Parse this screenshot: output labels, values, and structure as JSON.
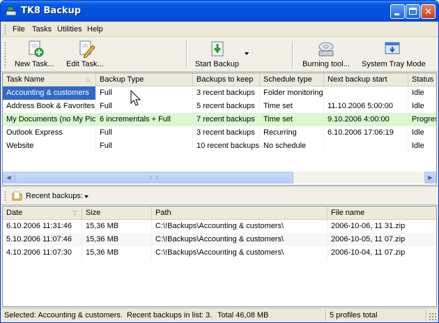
{
  "window": {
    "title": "TK8 Backup"
  },
  "menu": {
    "items": [
      "File",
      "Tasks",
      "Utilities",
      "Help"
    ]
  },
  "toolbar": {
    "new_task": "New Task...",
    "edit_task": "Edit Task...",
    "start_backup": "Start Backup",
    "burning_tools": "Burning tool...",
    "system_tray": "System Tray Mode"
  },
  "tasks": {
    "columns": [
      "Task Name",
      "Backup Type",
      "Backups to keep",
      "Schedule type",
      "Next backup start",
      "Status"
    ],
    "rows": [
      {
        "name": "Accounting & customers",
        "type": "Full",
        "keep": "3 recent backups",
        "schedule": "Folder monitoring",
        "next": "",
        "status": "Idle"
      },
      {
        "name": "Address Book & Favorites",
        "type": "Full",
        "keep": "5 recent backups",
        "schedule": "Time set",
        "next": "11.10.2006 5:00:00",
        "status": "Idle"
      },
      {
        "name": "My Documents (no My Pictu",
        "type": "6 incrementals + Full",
        "keep": "7 recent backups",
        "schedule": "Time set",
        "next": "9.10.2006 4:00:00",
        "status": "Progres"
      },
      {
        "name": "Outlook Express",
        "type": "Full",
        "keep": "3 recent backups",
        "schedule": "Recurring",
        "next": "6.10.2006 17:06:19",
        "status": "Idle"
      },
      {
        "name": "Website",
        "type": "Full",
        "keep": "10 recent backups",
        "schedule": "No schedule",
        "next": "",
        "status": "Idle"
      }
    ]
  },
  "recent": {
    "label": "Recent backups:",
    "columns": [
      "Date",
      "Size",
      "Path",
      "File name"
    ],
    "rows": [
      {
        "date": "6.10.2006 11:31:46",
        "size": "15,36 MB",
        "path": "C:\\!Backups\\Accounting & customers\\",
        "file": "2006-10-06, 11 31.zip"
      },
      {
        "date": "5.10.2006 11:07:46",
        "size": "15,36 MB",
        "path": "C:\\!Backups\\Accounting & customers\\",
        "file": "2006-10-05, 11 07.zip"
      },
      {
        "date": "4.10.2006 11:07:30",
        "size": "15,36 MB",
        "path": "C:\\!Backups\\Accounting & customers\\",
        "file": "2006-10-04, 11 07.zip"
      }
    ]
  },
  "status": {
    "selected": "Selected: Accounting & customers.",
    "recent_count": "Recent backups in list: 3.",
    "total": "Total 46,08 MB",
    "profiles": "5 profiles total"
  },
  "colors": {
    "selection": "#316ac5",
    "progress_row": "#d8f8d0",
    "titlebar": "#0352df"
  }
}
